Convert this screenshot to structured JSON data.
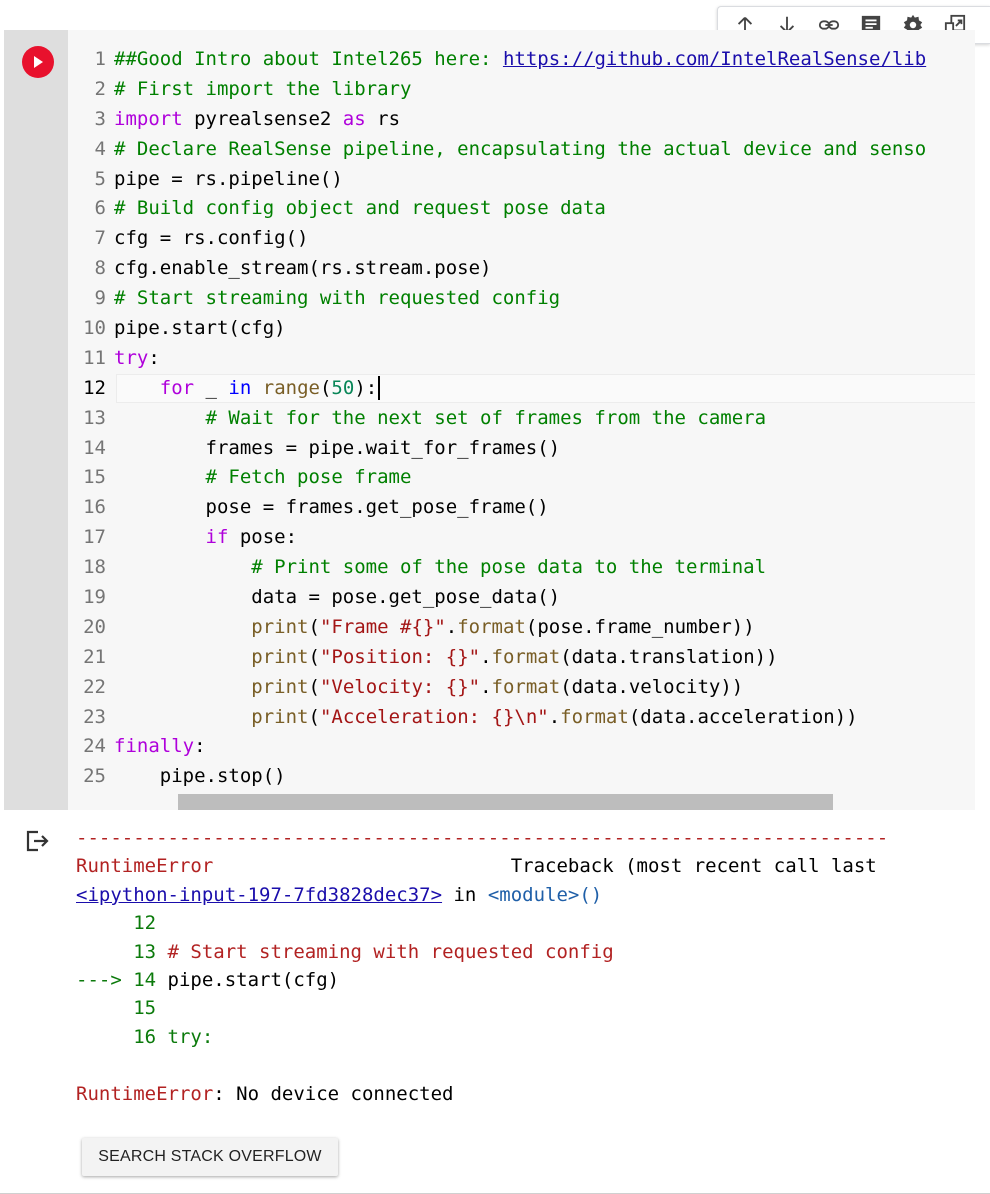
{
  "toolbar": {
    "icons": [
      "arrow-up-icon",
      "arrow-down-icon",
      "link-icon",
      "comment-icon",
      "gear-icon",
      "mirror-cell-icon"
    ]
  },
  "cell": {
    "line_numbers": [
      "1",
      "2",
      "3",
      "4",
      "5",
      "6",
      "7",
      "8",
      "9",
      "10",
      "11",
      "12",
      "13",
      "14",
      "15",
      "16",
      "17",
      "18",
      "19",
      "20",
      "21",
      "22",
      "23",
      "24",
      "25"
    ],
    "active_line": "12",
    "code": {
      "l1_comment": "##Good Intro about Intel265 here: ",
      "l1_link": "https://github.com/IntelRealSense/lib",
      "l2": "# First import the library",
      "l3_kw": "import",
      "l3_rest": " pyrealsense2 ",
      "l3_as": "as",
      "l3_alias": " rs",
      "l4": "# Declare RealSense pipeline, encapsulating the actual device and senso",
      "l5": "pipe = rs.pipeline()",
      "l6": "# Build config object and request pose data",
      "l7": "cfg = rs.config()",
      "l8": "cfg.enable_stream(rs.stream.pose)",
      "l9": "# Start streaming with requested config",
      "l10": "pipe.start(cfg)",
      "l11_kw": "try",
      "l11_rest": ":",
      "l12_indent": "    ",
      "l12_for": "for",
      "l12_var": " _ ",
      "l12_in": "in",
      "l12_sp": " ",
      "l12_range": "range",
      "l12_open": "(",
      "l12_num": "50",
      "l12_close": "):",
      "l13": "        # Wait for the next set of frames from the camera",
      "l14": "        frames = pipe.wait_for_frames()",
      "l15": "        # Fetch pose frame",
      "l16": "        pose = frames.get_pose_frame()",
      "l17_indent": "        ",
      "l17_kw": "if",
      "l17_rest": " pose:",
      "l18": "            # Print some of the pose data to the terminal",
      "l19": "            data = pose.get_pose_data()",
      "l20_indent": "            ",
      "l20_fn": "print",
      "l20_open": "(",
      "l20_str": "\"Frame #{}\"",
      "l20_dot": ".",
      "l20_fmt": "format",
      "l20_rest": "(pose.frame_number))",
      "l21_indent": "            ",
      "l21_fn": "print",
      "l21_open": "(",
      "l21_str": "\"Position: {}\"",
      "l21_dot": ".",
      "l21_fmt": "format",
      "l21_rest": "(data.translation))",
      "l22_indent": "            ",
      "l22_fn": "print",
      "l22_open": "(",
      "l22_str": "\"Velocity: {}\"",
      "l22_dot": ".",
      "l22_fmt": "format",
      "l22_rest": "(data.velocity))",
      "l23_indent": "            ",
      "l23_fn": "print",
      "l23_open": "(",
      "l23_str": "\"Acceleration: {}\\n\"",
      "l23_dot": ".",
      "l23_fmt": "format",
      "l23_rest": "(data.acceleration))",
      "l24_kw": "finally",
      "l24_rest": ":",
      "l25": "    pipe.stop()"
    }
  },
  "output": {
    "dashes": "-----------------------------------------------------------------------",
    "error_name": "RuntimeError",
    "traceback_header": "                          Traceback (most recent call last",
    "input_link": "<ipython-input-197-7fd3828dec37>",
    "in_text": " in ",
    "module": "<module>",
    "module_parens": "()",
    "tb_lines": [
      {
        "prefix": "     ",
        "num": "12",
        "code": ""
      },
      {
        "prefix": "     ",
        "num": "13",
        "code": " # Start streaming with requested config"
      },
      {
        "prefix": "---> ",
        "num": "14",
        "code": " pipe.start(cfg)"
      },
      {
        "prefix": "     ",
        "num": "15",
        "code": ""
      },
      {
        "prefix": "     ",
        "num": "16",
        "code": " try:"
      }
    ],
    "final_error_name": "RuntimeError",
    "final_error_msg": ": No device connected",
    "search_button": "SEARCH STACK OVERFLOW"
  }
}
